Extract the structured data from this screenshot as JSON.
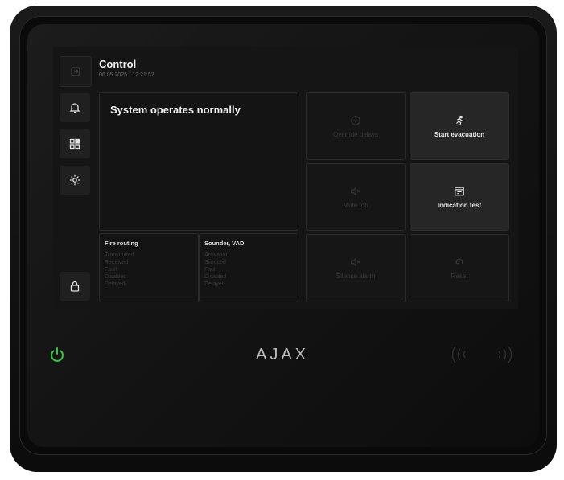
{
  "header": {
    "title": "Control",
    "datetime": "06.05.2025 · 12:21:52"
  },
  "status": {
    "message": "System operates normally"
  },
  "tiles": {
    "override_delays": "Override delays",
    "start_evacuation": "Start evacuation",
    "mute_fob": "Mute fob",
    "indication_test": "Indication test",
    "silence_alarm": "Silence alarm",
    "reset": "Reset"
  },
  "fire_routing": {
    "title": "Fire routing",
    "items": [
      "Transmitted",
      "Received",
      "Fault",
      "Disabled",
      "Delayed"
    ]
  },
  "sounder_vad": {
    "title": "Sounder, VAD",
    "items": [
      "Activation",
      "Silenced",
      "Fault",
      "Disabled",
      "Delayed"
    ]
  },
  "brand": {
    "logo": "AJAX"
  },
  "colors": {
    "power_led": "#2ecc40",
    "text_primary": "#e6e6e6",
    "text_dim": "#3a3a3a",
    "screen_bg": "#151515"
  },
  "icons": [
    "exit-icon",
    "bell-icon",
    "grid-icon",
    "gear-icon",
    "lock-icon",
    "power-icon",
    "nfc-icon",
    "info-icon",
    "run-icon",
    "mute-icon",
    "test-icon",
    "reset-icon"
  ]
}
